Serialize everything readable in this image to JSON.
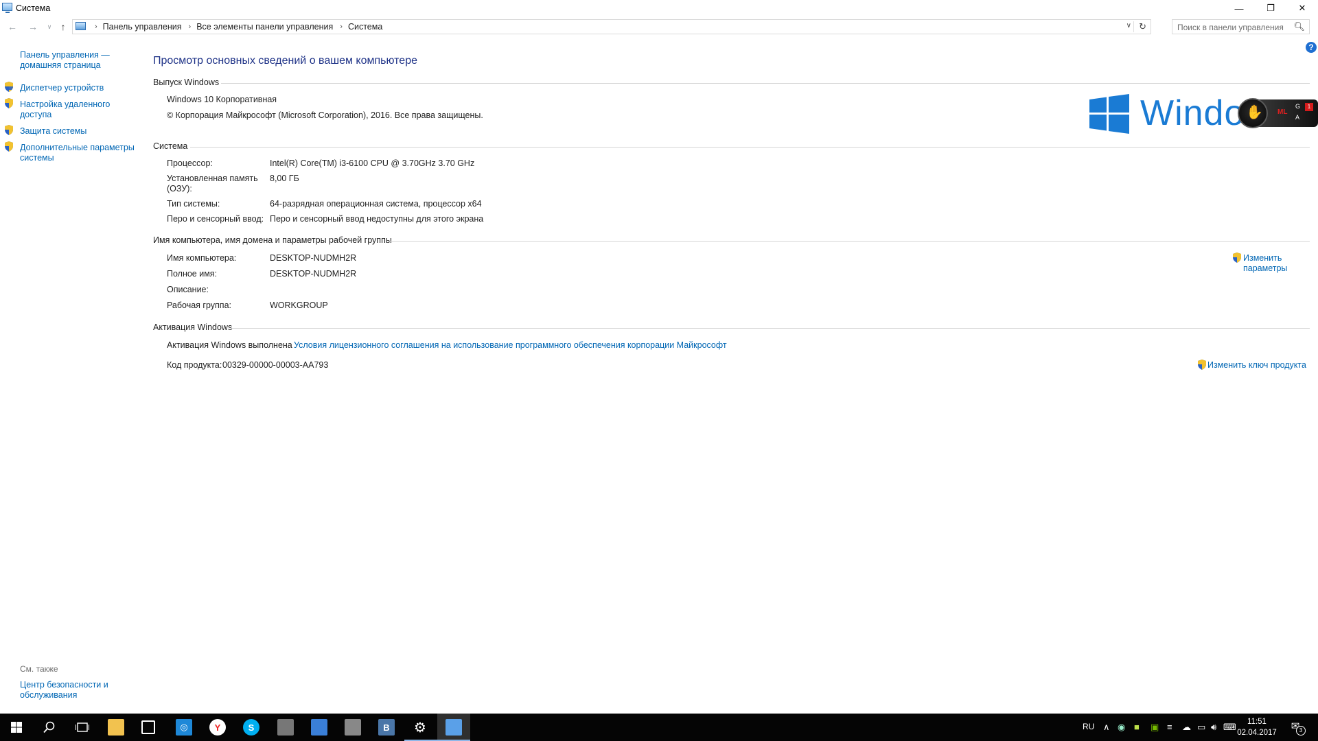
{
  "window": {
    "title": "Система"
  },
  "address_bar": {
    "crumbs": [
      "Панель управления",
      "Все элементы панели управления",
      "Система"
    ],
    "search_placeholder": "Поиск в панели управления"
  },
  "left_pane": {
    "home_link": "Панель управления — домашняя страница",
    "links": [
      {
        "label": "Диспетчер устройств",
        "icon": "shield-icon"
      },
      {
        "label": "Настройка удаленного доступа",
        "icon": "shield-icon"
      },
      {
        "label": "Защита системы",
        "icon": "shield-icon"
      },
      {
        "label": "Дополнительные параметры системы",
        "icon": "shield-icon"
      }
    ],
    "see_also_header": "См. также",
    "see_also_link": "Центр безопасности и обслуживания"
  },
  "main": {
    "page_title": "Просмотр основных сведений о вашем компьютере",
    "edition": {
      "header": "Выпуск Windows",
      "name": "Windows 10 Корпоративная",
      "copyright": "© Корпорация Майкрософт (Microsoft Corporation), 2016. Все права защищены.",
      "logo_text": "Windows"
    },
    "system": {
      "header": "Система",
      "rows": [
        {
          "label": "Процессор:",
          "value": "Intel(R) Core(TM) i3-6100 CPU @ 3.70GHz   3.70 GHz"
        },
        {
          "label": "Установленная память (ОЗУ):",
          "value": "8,00 ГБ"
        },
        {
          "label": "Тип системы:",
          "value": "64-разрядная операционная система, процессор x64"
        },
        {
          "label": "Перо и сенсорный ввод:",
          "value": "Перо и сенсорный ввод недоступны для этого экрана"
        }
      ]
    },
    "computer": {
      "header": "Имя компьютера, имя домена и параметры рабочей группы",
      "rows": [
        {
          "label": "Имя компьютера:",
          "value": "DESKTOP-NUDMH2R"
        },
        {
          "label": "Полное имя:",
          "value": "DESKTOP-NUDMH2R"
        },
        {
          "label": "Описание:",
          "value": ""
        },
        {
          "label": "Рабочая группа:",
          "value": "WORKGROUP"
        }
      ],
      "change_link": "Изменить параметры"
    },
    "activation": {
      "header": "Активация Windows",
      "status": "Активация Windows выполнена",
      "license_link": "Условия лицензионного соглашения на использование программного обеспечения корпорации Майкрософт",
      "product_key_label": "Код продукта:",
      "product_key": "00329-00000-00003-AA793",
      "change_key_link": "Изменить ключ продукта"
    }
  },
  "overlay_widget": {
    "ml": "ML",
    "g": "G",
    "a": "A",
    "badge": "1"
  },
  "taskbar": {
    "apps": [
      {
        "name": "file-explorer",
        "color": "#f2c24f"
      },
      {
        "name": "store",
        "color": "#ffffff"
      },
      {
        "name": "camera-app",
        "color": "#1e88d8"
      },
      {
        "name": "yandex-browser",
        "color": "#ffffff"
      },
      {
        "name": "skype",
        "color": "#00aff0"
      },
      {
        "name": "app-generic",
        "color": "#777777"
      },
      {
        "name": "app-blue-bird",
        "color": "#3a7fd8"
      },
      {
        "name": "app-computer",
        "color": "#888888"
      },
      {
        "name": "vk",
        "color": "#4a76a8"
      },
      {
        "name": "settings",
        "color": "#ffffff"
      },
      {
        "name": "control-panel-system",
        "color": "#5aa0e8"
      }
    ],
    "language": "RU",
    "time": "11:51",
    "date": "02.04.2017",
    "notification_count": "3"
  }
}
